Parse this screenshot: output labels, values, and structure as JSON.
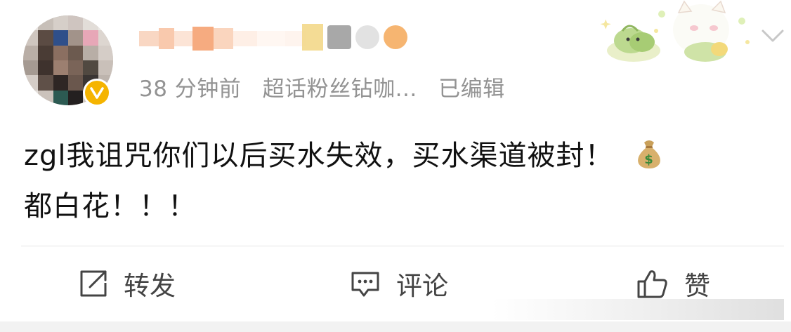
{
  "post": {
    "time": "38 分钟前",
    "source": "超话粉丝钻咖...",
    "edited": "已编辑",
    "content_line1": "zgl我诅咒你们以后买水失效，买水渠道被封！",
    "content_line2": "都白花！！！"
  },
  "actions": {
    "repost_label": "转发",
    "comment_label": "评论",
    "like_label": "赞"
  },
  "icons": {
    "verified": "verified-badge-icon",
    "more": "chevron-down-icon",
    "repost": "share-icon",
    "comment": "comment-icon",
    "like": "thumbs-up-icon",
    "emoji": "money-bag-icon"
  },
  "colors": {
    "verified": "#f5b400",
    "meta_text": "#939393",
    "action_text": "#444444",
    "divider": "#e6e6e6"
  }
}
